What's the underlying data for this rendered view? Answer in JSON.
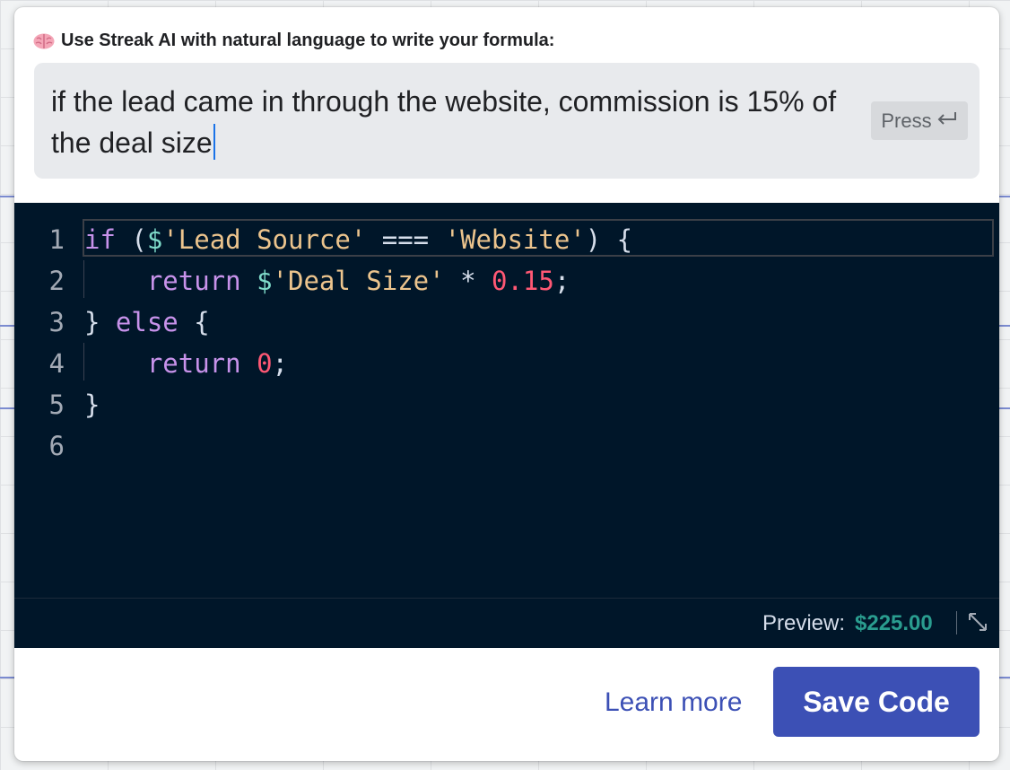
{
  "ai_prompt": {
    "header": "Use Streak AI with natural language to write your formula:",
    "header_icon": "brain-icon",
    "input_value": "if the lead came in through the website, commission is 15% of the deal size",
    "press_label": "Press",
    "press_icon": "enter-key-icon"
  },
  "editor": {
    "line_numbers": [
      "1",
      "2",
      "3",
      "4",
      "5",
      "6"
    ],
    "code": {
      "l1_kw": "if",
      "l1_a": " (",
      "l1_dollar": "$",
      "l1_str1": "'Lead Source'",
      "l1_b": " === ",
      "l1_str2": "'Website'",
      "l1_c": ") {",
      "l2_indent": "    ",
      "l2_kw": "return",
      "l2_sp": " ",
      "l2_dollar": "$",
      "l2_str": "'Deal Size'",
      "l2_op": " * ",
      "l2_num": "0.15",
      "l2_end": ";",
      "l3_a": "} ",
      "l3_kw": "else",
      "l3_b": " {",
      "l4_indent": "    ",
      "l4_kw": "return",
      "l4_sp": " ",
      "l4_num": "0",
      "l4_end": ";",
      "l5": "}"
    },
    "preview_label": "Preview:",
    "preview_value": "$225.00",
    "expand_icon": "expand-icon"
  },
  "footer": {
    "learn_more": "Learn more",
    "save_code": "Save Code"
  },
  "colors": {
    "editor_bg": "#001629",
    "accent": "#3c50b5",
    "preview_value": "#2a9d8f",
    "keyword": "#c792ea",
    "string": "#ecc48d",
    "number": "#ff5874"
  }
}
